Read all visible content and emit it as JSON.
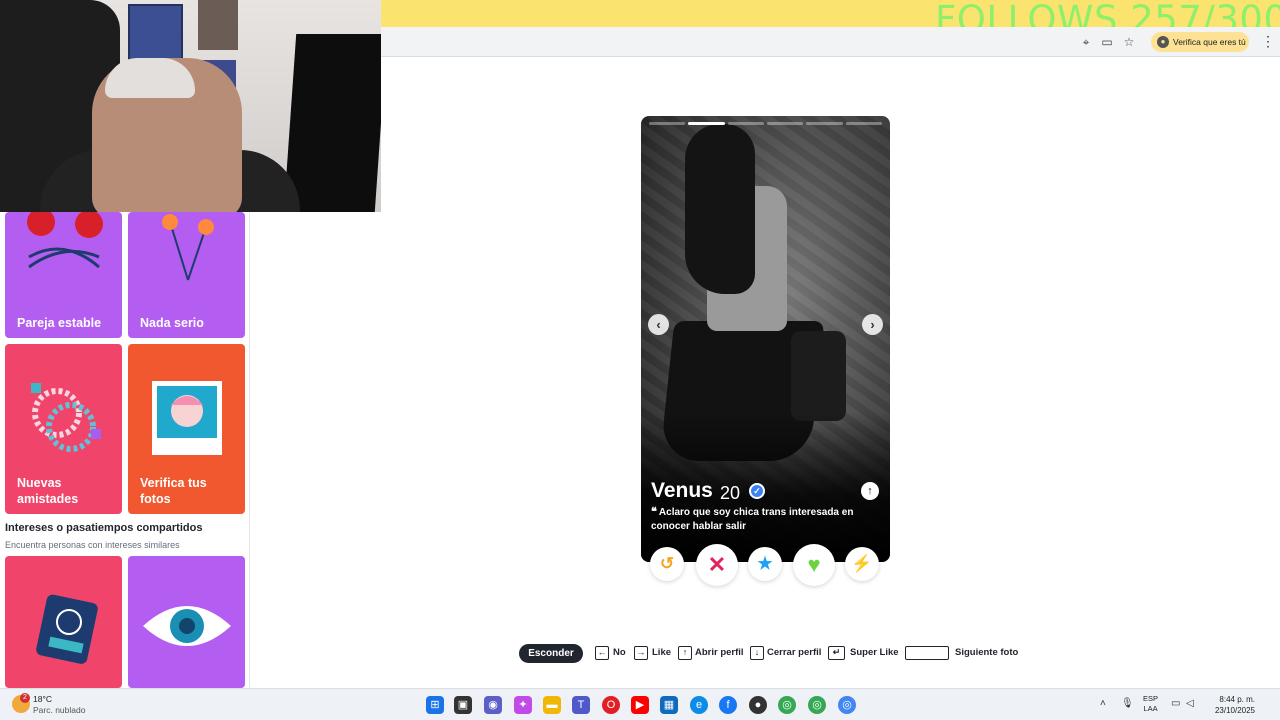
{
  "overlay": {
    "follows_counter": "FOLLOWS 257/300"
  },
  "browser": {
    "verify_label": "Verifica que eres tú",
    "kebab": "⋮"
  },
  "sidebar": {
    "cards": [
      {
        "label": "Pareja estable",
        "color": "#b35ef0"
      },
      {
        "label": "Nada serio",
        "color": "#b35ef0"
      },
      {
        "label": "Nuevas amistades",
        "color": "#f0446a"
      },
      {
        "label": "Verifica tus fotos",
        "color": "#f2582f"
      }
    ],
    "section_title": "Intereses o pasatiempos compartidos",
    "section_subtitle": "Encuentra personas con intereses similares",
    "interest_cards": [
      {
        "icon": "passport-icon",
        "color": "#f0446a"
      },
      {
        "icon": "eye-icon",
        "color": "#b35ef0"
      }
    ]
  },
  "profile": {
    "name": "Venus",
    "age": "20",
    "bio": "Aclaro que soy chica trans interesada en conocer hablar salir",
    "photo_index": 2,
    "photo_count": 6,
    "verified": true
  },
  "actions": {
    "rewind": "↺",
    "nope": "✕",
    "super_like": "★",
    "like": "♥",
    "boost": "⚡"
  },
  "shortcuts": {
    "hide": "Esconder",
    "no": "No",
    "like": "Like",
    "open_profile": "Abrir perfil",
    "close_profile": "Cerrar perfil",
    "super_like": "Super Like",
    "next_photo": "Siguiente foto"
  },
  "taskbar": {
    "weather_temp": "18°C",
    "weather_desc": "Parc. nublado",
    "weather_alerts": "2",
    "lang_top": "ESP",
    "lang_bottom": "LAA",
    "time": "8:44 p. m.",
    "date": "23/10/2025"
  }
}
